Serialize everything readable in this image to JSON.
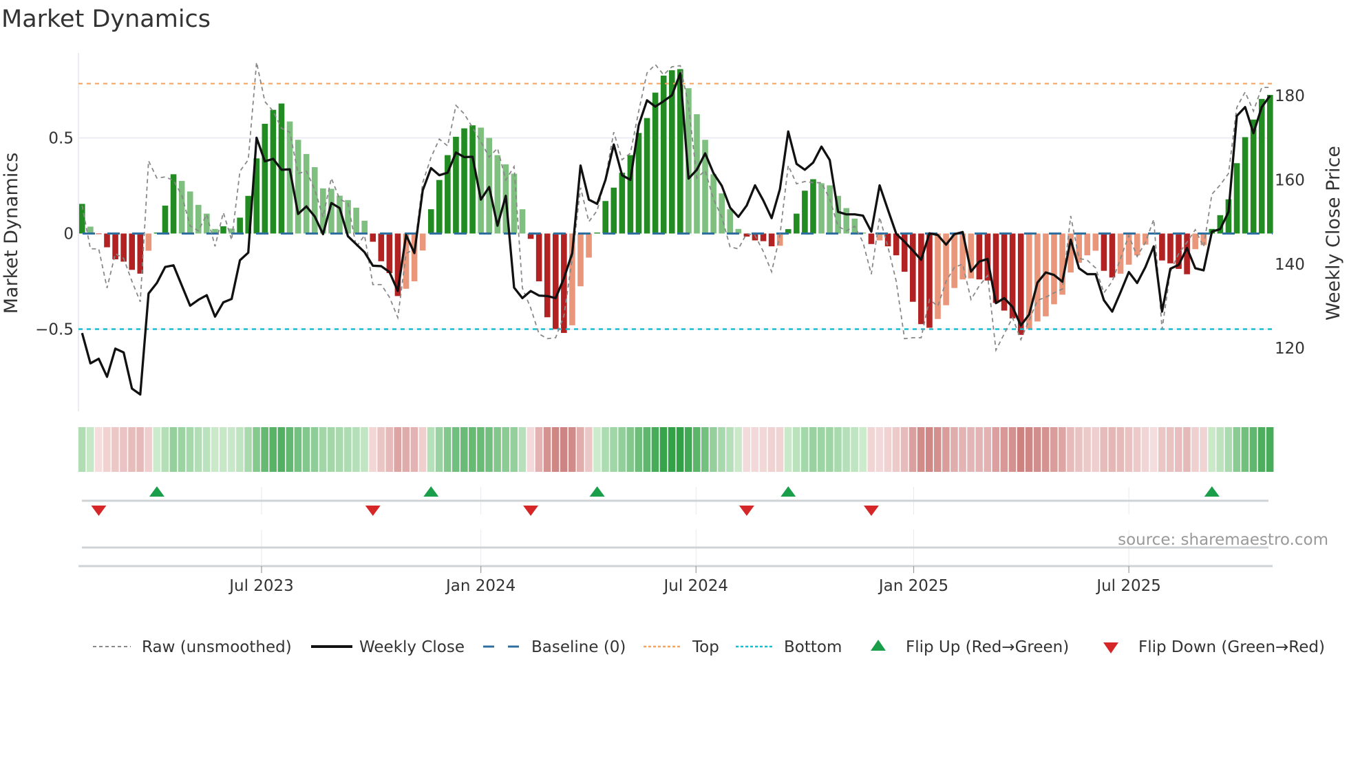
{
  "title": "Market Dynamics",
  "source": "source: sharemaestro.com",
  "colors": {
    "green_dark": "#228b22",
    "green_light": "#7fbf7f",
    "red_dark": "#b22222",
    "red_light": "#e9967a",
    "raw": "#888888",
    "close": "#111111",
    "baseline": "#2f6f9f",
    "top": "#f4a460",
    "bottom": "#17becf",
    "flip_up": "#1a9e4a",
    "flip_down": "#d62728"
  },
  "legend": [
    {
      "key": "raw",
      "label": "Raw (unsmoothed)"
    },
    {
      "key": "close",
      "label": "Weekly Close"
    },
    {
      "key": "baseline",
      "label": "Baseline (0)"
    },
    {
      "key": "top",
      "label": "Top"
    },
    {
      "key": "bottom",
      "label": "Bottom"
    },
    {
      "key": "flip_up",
      "label": "Flip Up (Red→Green)"
    },
    {
      "key": "flip_down",
      "label": "Flip Down (Green→Red)"
    }
  ],
  "chart_data": {
    "type": "bar",
    "title": "Market Dynamics",
    "xlabel": "",
    "ylabel": "Market Dynamics",
    "ylabel_right": "Weekly Close Price",
    "ylim": [
      -0.93,
      0.93
    ],
    "ylim_right": [
      105,
      189.5
    ],
    "yticks": [
      {
        "v": 0.5,
        "label": "0.5"
      },
      {
        "v": 0,
        "label": "0"
      },
      {
        "v": -0.5,
        "label": "−0.5"
      }
    ],
    "yticks_right": [
      {
        "v": 180,
        "label": "180"
      },
      {
        "v": 160,
        "label": "160"
      },
      {
        "v": 140,
        "label": "140"
      },
      {
        "v": 120,
        "label": "120"
      }
    ],
    "x_unit": "week index",
    "xticks": [
      {
        "week": 21.6,
        "label": "Jul 2023"
      },
      {
        "week": 48.0,
        "label": "Jan 2024"
      },
      {
        "week": 73.9,
        "label": "Jul 2024"
      },
      {
        "week": 100.1,
        "label": "Jan 2025"
      },
      {
        "week": 126.0,
        "label": "Jul 2025"
      }
    ],
    "grid": true,
    "legend_position": "bottom",
    "top_level": 0.784,
    "bottom_level": -0.5,
    "baseline": 0,
    "dynamics": [
      0.155,
      0.036,
      -0.003,
      -0.072,
      -0.135,
      -0.147,
      -0.19,
      -0.21,
      -0.09,
      0.005,
      0.146,
      0.31,
      0.275,
      0.22,
      0.15,
      0.104,
      0.024,
      0.038,
      0.026,
      0.083,
      0.197,
      0.393,
      0.574,
      0.647,
      0.68,
      0.586,
      0.49,
      0.416,
      0.347,
      0.236,
      0.234,
      0.198,
      0.175,
      0.135,
      0.067,
      -0.043,
      -0.145,
      -0.207,
      -0.327,
      -0.289,
      -0.25,
      -0.089,
      0.127,
      0.28,
      0.41,
      0.506,
      0.55,
      0.566,
      0.554,
      0.5,
      0.41,
      0.362,
      0.313,
      0.127,
      -0.028,
      -0.25,
      -0.438,
      -0.5,
      -0.52,
      -0.48,
      -0.276,
      -0.126,
      0.005,
      0.17,
      0.24,
      0.318,
      0.41,
      0.526,
      0.604,
      0.737,
      0.826,
      0.854,
      0.86,
      0.76,
      0.624,
      0.49,
      0.31,
      0.21,
      0.127,
      0.024,
      -0.016,
      -0.036,
      -0.04,
      -0.067,
      -0.064,
      0.023,
      0.104,
      0.224,
      0.284,
      0.263,
      0.252,
      0.197,
      0.133,
      0.078,
      0.005,
      -0.055,
      -0.036,
      -0.067,
      -0.114,
      -0.2,
      -0.357,
      -0.474,
      -0.493,
      -0.447,
      -0.375,
      -0.285,
      -0.24,
      -0.235,
      -0.24,
      -0.246,
      -0.363,
      -0.403,
      -0.444,
      -0.53,
      -0.5,
      -0.46,
      -0.433,
      -0.37,
      -0.32,
      -0.204,
      -0.153,
      -0.114,
      -0.09,
      -0.195,
      -0.23,
      -0.21,
      -0.163,
      -0.114,
      -0.058,
      -0.005,
      -0.141,
      -0.156,
      -0.185,
      -0.213,
      -0.082,
      -0.061,
      0.024,
      0.096,
      0.179,
      0.368,
      0.504,
      0.596,
      0.704,
      0.725
    ],
    "raw": [
      0.146,
      -0.08,
      -0.08,
      -0.285,
      -0.105,
      -0.13,
      -0.25,
      -0.357,
      0.38,
      0.29,
      0.296,
      0.278,
      0.2,
      0.04,
      0.014,
      0.1,
      -0.067,
      0.11,
      -0.034,
      0.326,
      0.386,
      0.896,
      0.69,
      0.64,
      0.55,
      0.53,
      0.314,
      0.326,
      0.23,
      0.086,
      0.29,
      0.18,
      0.158,
      -0.07,
      -0.01,
      -0.267,
      -0.267,
      -0.333,
      -0.44,
      -0.105,
      -0.08,
      0.266,
      0.398,
      0.494,
      0.458,
      0.67,
      0.626,
      0.554,
      0.48,
      0.4,
      0.446,
      0.28,
      0.35,
      -0.285,
      -0.39,
      -0.525,
      -0.55,
      -0.545,
      -0.43,
      -0.13,
      0.24,
      0.062,
      0.12,
      0.29,
      0.53,
      0.386,
      0.42,
      0.64,
      0.84,
      0.884,
      0.83,
      0.872,
      0.878,
      0.67,
      0.29,
      0.33,
      0.18,
      0.086,
      -0.07,
      -0.08,
      0,
      -0.01,
      -0.094,
      -0.2,
      -0.01,
      0.356,
      0.26,
      0.272,
      0.266,
      0.266,
      0.18,
      0.038,
      0.014,
      0.038,
      -0.046,
      -0.213,
      0.086,
      -0.07,
      -0.25,
      -0.55,
      -0.545,
      -0.545,
      -0.345,
      -0.38,
      -0.25,
      -0.177,
      -0.16,
      -0.345,
      -0.273,
      -0.22,
      -0.61,
      -0.525,
      -0.44,
      -0.555,
      -0.453,
      -0.35,
      -0.333,
      -0.31,
      -0.29,
      0.092,
      -0.13,
      -0.14,
      -0.18,
      -0.31,
      -0.25,
      -0.13,
      -0.01,
      -0.12,
      -0.046,
      0.074,
      -0.5,
      -0.2,
      -0.105,
      -0.046,
      0.02,
      -0.07,
      0.206,
      0.254,
      0.314,
      0.66,
      0.74,
      0.64,
      0.764,
      0.764
    ],
    "close": [
      123.6,
      116.4,
      117.5,
      113.2,
      119.9,
      119.0,
      110.4,
      109.0,
      133.0,
      135.5,
      139.3,
      139.7,
      134.9,
      130.1,
      131.5,
      132.6,
      127.5,
      130.9,
      131.7,
      140.9,
      142.7,
      170.0,
      164.4,
      165.0,
      162.4,
      162.5,
      151.9,
      153.7,
      151.3,
      147.1,
      154.5,
      153.3,
      146.6,
      144.7,
      142.8,
      139.6,
      139.5,
      138.1,
      133.6,
      146.9,
      142.6,
      157.5,
      162.8,
      161.1,
      161.7,
      166.5,
      165.4,
      165.5,
      155.3,
      158.3,
      149.1,
      156.2,
      134.4,
      131.9,
      133.6,
      132.5,
      132.4,
      131.9,
      136.6,
      142.6,
      163.4,
      155.3,
      154.3,
      160.0,
      168.4,
      161.1,
      160.0,
      173.0,
      178.9,
      177.4,
      178.7,
      180.1,
      185.3,
      160.3,
      162.4,
      166.3,
      161.6,
      158.6,
      153.4,
      151.2,
      153.9,
      158.7,
      155.1,
      150.9,
      157.8,
      171.5,
      163.8,
      162.4,
      164.1,
      167.9,
      164.7,
      152.4,
      151.8,
      151.8,
      151.5,
      147.7,
      158.7,
      152.9,
      147.2,
      145.3,
      143.2,
      141.0,
      147.3,
      146.9,
      144.6,
      147.1,
      147.6,
      138.2,
      140.6,
      141.2,
      130.7,
      131.9,
      129.8,
      125.4,
      128.0,
      135.6,
      138.0,
      137.4,
      135.8,
      145.8,
      139.0,
      137.6,
      137.6,
      131.4,
      128.7,
      133.3,
      138.1,
      135.5,
      139.3,
      144.2,
      128.7,
      138.9,
      139.8,
      143.8,
      139.0,
      138.5,
      147.7,
      148.3,
      152.4,
      175.2,
      177.3,
      171.1,
      177.3,
      180.0
    ],
    "flip_up_weeks": [
      9,
      42,
      62,
      85,
      136
    ],
    "flip_down_weeks": [
      2,
      35,
      54,
      80,
      95
    ]
  }
}
